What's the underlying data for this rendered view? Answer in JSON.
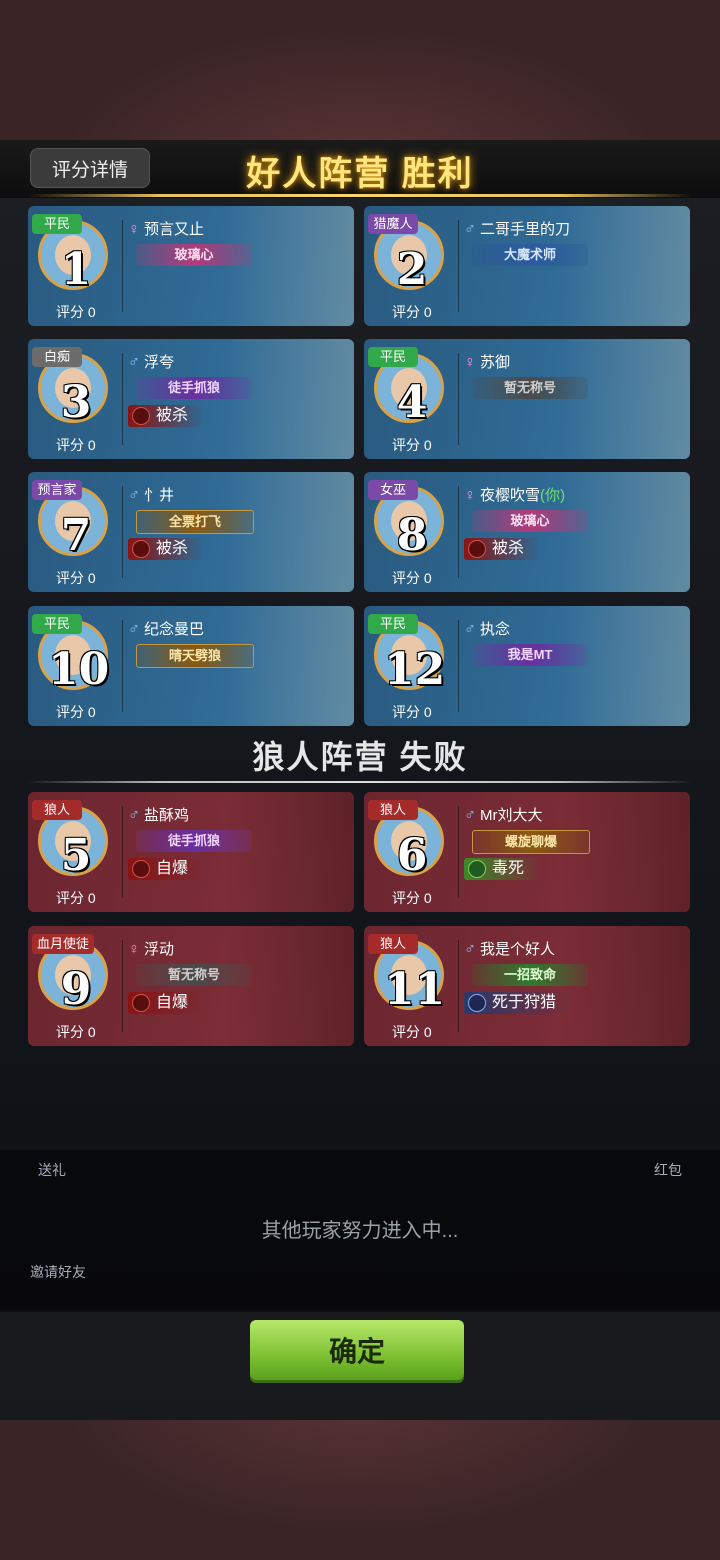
{
  "header": {
    "score_detail_label": "评分详情",
    "good_camp_title": "好人阵营  胜利",
    "wolf_camp_title": "狼人阵营  失败"
  },
  "score_text": "评分",
  "good_players": [
    {
      "seat": "1",
      "role": "平民",
      "role_color": "green",
      "gender": "♀",
      "gender_type": "female",
      "name": "预言又止",
      "title": "玻璃心",
      "title_style": "pink",
      "death": "",
      "score": "0"
    },
    {
      "seat": "2",
      "role": "猎魔人",
      "role_color": "purple",
      "gender": "♂",
      "gender_type": "male",
      "name": "二哥手里的刀",
      "title": "大魔术师",
      "title_style": "blue",
      "death": "",
      "score": "0"
    },
    {
      "seat": "3",
      "role": "白痴",
      "role_color": "gray",
      "gender": "♂",
      "gender_type": "male",
      "name": "浮夸",
      "title": "徒手抓狼",
      "title_style": "purple",
      "death": "被杀",
      "death_style": "red",
      "score": "0"
    },
    {
      "seat": "4",
      "role": "平民",
      "role_color": "green",
      "gender": "♀",
      "gender_type": "female",
      "name": "苏御",
      "title": "暂无称号",
      "title_style": "gray",
      "death": "",
      "score": "0"
    },
    {
      "seat": "7",
      "role": "预言家",
      "role_color": "purple",
      "gender": "♂",
      "gender_type": "male",
      "name": "忄井",
      "title": "全票打飞",
      "title_style": "gold",
      "death": "被杀",
      "death_style": "red",
      "score": "0"
    },
    {
      "seat": "8",
      "role": "女巫",
      "role_color": "purple",
      "gender": "♀",
      "gender_type": "female",
      "name": "夜樱吹雪",
      "you": "(你)",
      "title": "玻璃心",
      "title_style": "pink",
      "death": "被杀",
      "death_style": "red",
      "score": "0"
    },
    {
      "seat": "10",
      "role": "平民",
      "role_color": "green",
      "gender": "♂",
      "gender_type": "male",
      "name": "纪念曼巴",
      "title": "晴天劈狼",
      "title_style": "gold",
      "death": "",
      "score": "0"
    },
    {
      "seat": "12",
      "role": "平民",
      "role_color": "green",
      "gender": "♂",
      "gender_type": "male",
      "name": "执念",
      "title": "我是MT",
      "title_style": "purple",
      "death": "",
      "score": "0"
    }
  ],
  "wolf_players": [
    {
      "seat": "5",
      "role": "狼人",
      "role_color": "red",
      "gender": "♂",
      "gender_type": "male",
      "name": "盐酥鸡",
      "title": "徒手抓狼",
      "title_style": "purple",
      "death": "自爆",
      "death_style": "red",
      "score": "0"
    },
    {
      "seat": "6",
      "role": "狼人",
      "role_color": "red",
      "gender": "♂",
      "gender_type": "male",
      "name": "Mr刘大大",
      "title": "螺旋聊爆",
      "title_style": "gold",
      "death": "毒死",
      "death_style": "green",
      "score": "0"
    },
    {
      "seat": "9",
      "role": "血月使徒",
      "role_color": "red",
      "gender": "♀",
      "gender_type": "female",
      "name": "浮动",
      "title": "暂无称号",
      "title_style": "gray",
      "death": "自爆",
      "death_style": "red",
      "score": "0"
    },
    {
      "seat": "11",
      "role": "狼人",
      "role_color": "red",
      "gender": "♂",
      "gender_type": "male",
      "name": "我是个好人",
      "title": "一招致命",
      "title_style": "green",
      "death": "死于狩猎",
      "death_style": "blue",
      "score": "0"
    }
  ],
  "background": {
    "waiting_text": "其他玩家努力进入中...",
    "gift_label": "送礼",
    "redpacket_label": "红包",
    "invite_label": "邀请好友"
  },
  "confirm_label": "确定"
}
